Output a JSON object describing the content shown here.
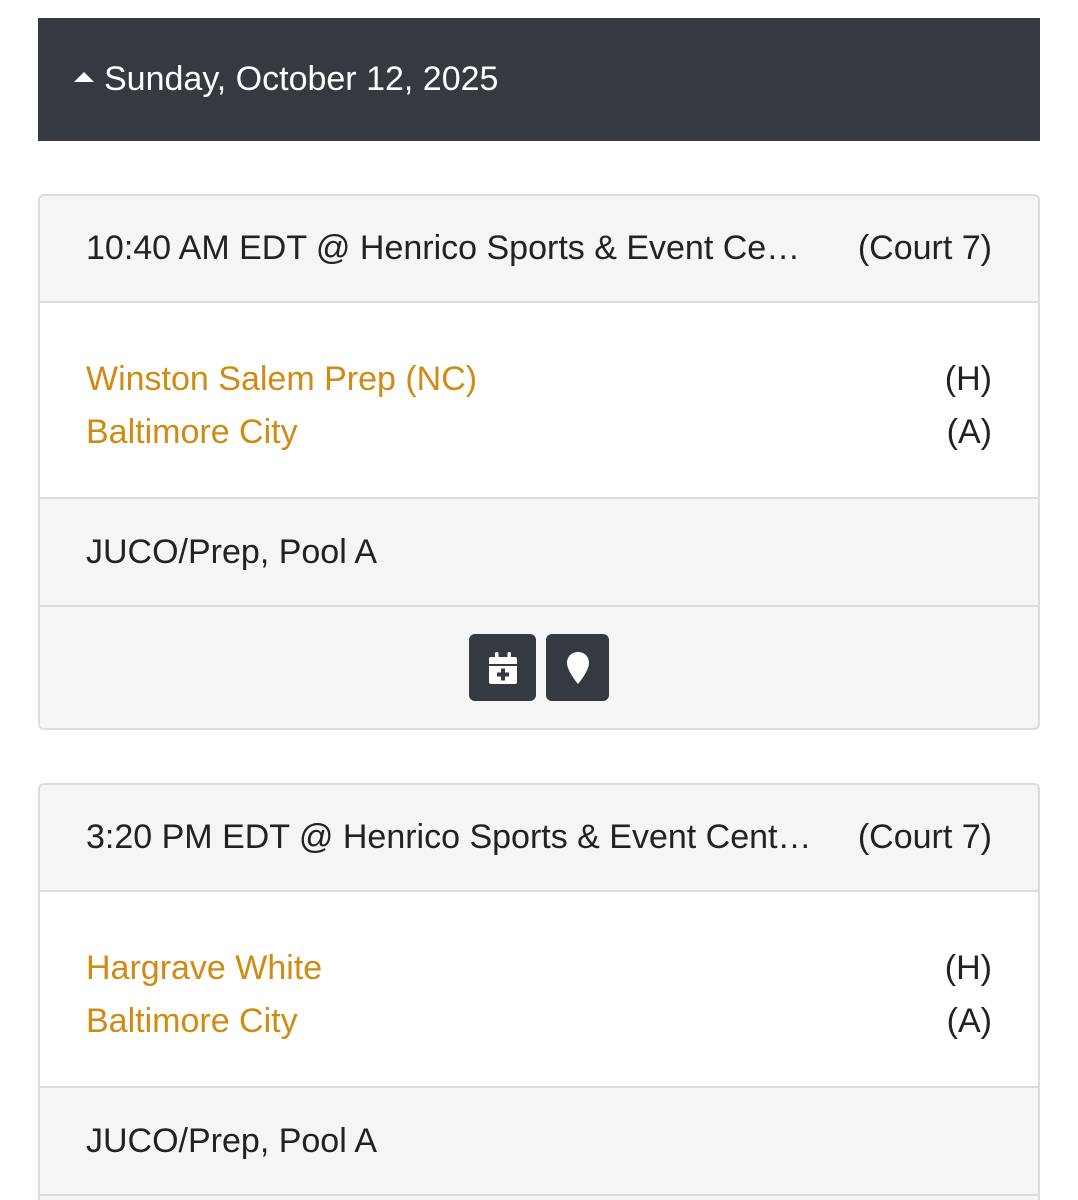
{
  "date_header": {
    "label": "Sunday, October 12, 2025",
    "icon": "caret-up-icon"
  },
  "colors": {
    "header_bg": "#343a40",
    "team_link": "#cf8b14",
    "card_bg": "#f5f5f5"
  },
  "games": [
    {
      "venue": "10:40 AM EDT @ Henrico Sports & Event Ce…",
      "court": "(Court 7)",
      "home_team": "Winston Salem Prep (NC)",
      "home_label": "(H)",
      "away_team": "Baltimore City",
      "away_label": "(A)",
      "division": "JUCO/Prep, Pool A",
      "actions": [
        "calendar-plus-icon",
        "map-marker-icon"
      ]
    },
    {
      "venue": "3:20 PM EDT @ Henrico Sports & Event Cent…",
      "court": "(Court 7)",
      "home_team": "Hargrave White",
      "home_label": "(H)",
      "away_team": "Baltimore City",
      "away_label": "(A)",
      "division": "JUCO/Prep, Pool A"
    }
  ]
}
